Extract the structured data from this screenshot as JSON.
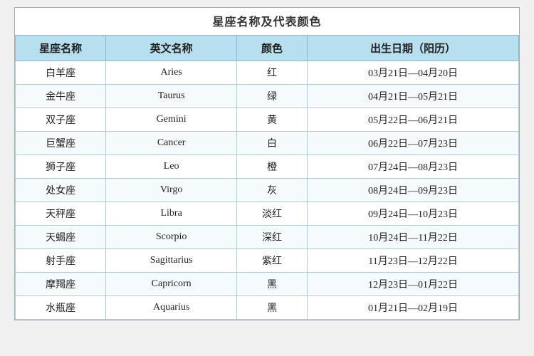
{
  "title": "星座名称及代表颜色",
  "headers": {
    "chinese_name": "星座名称",
    "english_name": "英文名称",
    "color": "颜色",
    "birthdate": "出生日期（阳历）"
  },
  "rows": [
    {
      "cn": "白羊座",
      "en": "Aries",
      "color": "红",
      "date": "03月21日—04月20日"
    },
    {
      "cn": "金牛座",
      "en": "Taurus",
      "color": "绿",
      "date": "04月21日—05月21日"
    },
    {
      "cn": "双子座",
      "en": "Gemini",
      "color": "黄",
      "date": "05月22日—06月21日"
    },
    {
      "cn": "巨蟹座",
      "en": "Cancer",
      "color": "白",
      "date": "06月22日—07月23日"
    },
    {
      "cn": "狮子座",
      "en": "Leo",
      "color": "橙",
      "date": "07月24日—08月23日"
    },
    {
      "cn": "处女座",
      "en": "Virgo",
      "color": "灰",
      "date": "08月24日—09月23日"
    },
    {
      "cn": "天秤座",
      "en": "Libra",
      "color": "淡红",
      "date": "09月24日—10月23日"
    },
    {
      "cn": "天蝎座",
      "en": "Scorpio",
      "color": "深红",
      "date": "10月24日—11月22日"
    },
    {
      "cn": "射手座",
      "en": "Sagittarius",
      "color": "紫红",
      "date": "11月23日—12月22日"
    },
    {
      "cn": "摩羯座",
      "en": "Capricorn",
      "color": "黑",
      "date": "12月23日—01月22日"
    },
    {
      "cn": "水瓶座",
      "en": "Aquarius",
      "color": "黑",
      "date": "01月21日—02月19日"
    }
  ]
}
